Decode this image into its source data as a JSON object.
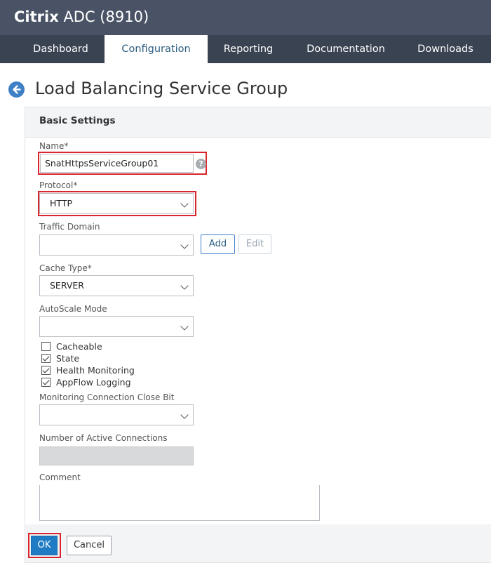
{
  "app": {
    "brand_bold": "Citrix",
    "brand_rest": "ADC (8910)"
  },
  "nav": {
    "tabs": [
      {
        "label": "Dashboard",
        "active": false
      },
      {
        "label": "Configuration",
        "active": true
      },
      {
        "label": "Reporting",
        "active": false
      },
      {
        "label": "Documentation",
        "active": false
      },
      {
        "label": "Downloads",
        "active": false
      }
    ]
  },
  "page": {
    "title": "Load Balancing Service Group",
    "back_icon": "arrow-left-circle-icon"
  },
  "form": {
    "section_title": "Basic Settings",
    "name": {
      "label": "Name*",
      "value": "SnatHttpsServiceGroup01",
      "help_glyph": "?"
    },
    "protocol": {
      "label": "Protocol*",
      "value": "HTTP"
    },
    "traffic_domain": {
      "label": "Traffic Domain",
      "value": "",
      "add_label": "Add",
      "edit_label": "Edit"
    },
    "cache_type": {
      "label": "Cache Type*",
      "value": "SERVER"
    },
    "autoscale_mode": {
      "label": "AutoScale Mode",
      "value": ""
    },
    "checkboxes": [
      {
        "label": "Cacheable",
        "checked": false
      },
      {
        "label": "State",
        "checked": true
      },
      {
        "label": "Health Monitoring",
        "checked": true
      },
      {
        "label": "AppFlow Logging",
        "checked": true
      }
    ],
    "monitoring_close_bit": {
      "label": "Monitoring Connection Close Bit",
      "value": ""
    },
    "active_connections": {
      "label": "Number of Active Connections",
      "value": ""
    },
    "comment": {
      "label": "Comment",
      "value": ""
    }
  },
  "actions": {
    "ok_label": "OK",
    "cancel_label": "Cancel"
  },
  "colors": {
    "header": "#495365",
    "navbar": "#3a4352",
    "accent": "#1f7bc4",
    "highlight": "#d9262e"
  }
}
